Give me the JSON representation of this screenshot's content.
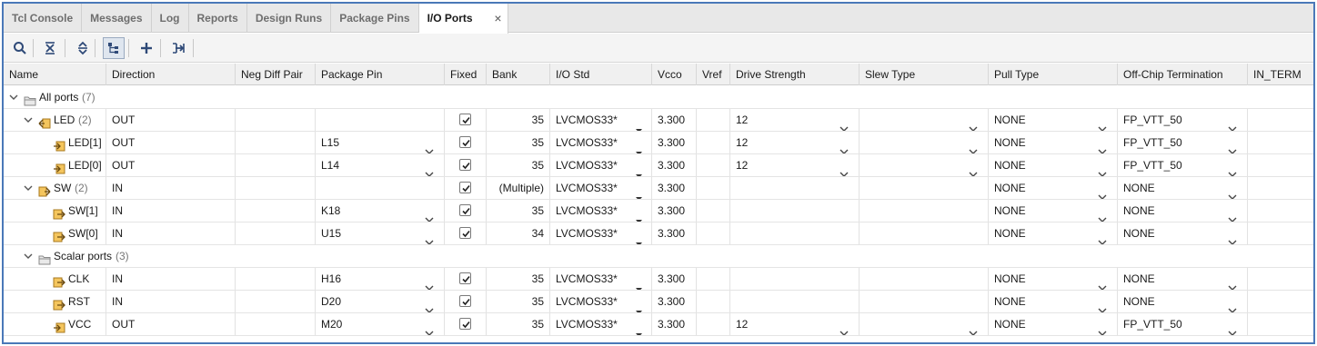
{
  "tabs": [
    {
      "label": "Tcl Console"
    },
    {
      "label": "Messages"
    },
    {
      "label": "Log"
    },
    {
      "label": "Reports"
    },
    {
      "label": "Design Runs"
    },
    {
      "label": "Package Pins"
    },
    {
      "label": "I/O Ports",
      "active": true
    }
  ],
  "toolbar": {
    "icons": [
      "search-icon",
      "collapse-all-icon",
      "expand-all-icon",
      "group-by-interface-icon",
      "add-icon",
      "export-icon"
    ]
  },
  "columns": [
    "Name",
    "Direction",
    "Neg Diff Pair",
    "Package Pin",
    "Fixed",
    "Bank",
    "I/O Std",
    "Vcco",
    "Vref",
    "Drive Strength",
    "Slew Type",
    "Pull Type",
    "Off-Chip Termination",
    "IN_TERM"
  ],
  "rows": [
    {
      "kind": "group",
      "name": "All ports",
      "count": "(7)"
    },
    {
      "kind": "bus",
      "name": "LED",
      "count": "(2)",
      "direction": "OUT",
      "pkg_pin": "",
      "fixed": true,
      "bank": "35",
      "io_std": "LVCMOS33*",
      "vcco": "3.300",
      "drive": "12",
      "slew": "",
      "pull": "NONE",
      "term": "FP_VTT_50"
    },
    {
      "kind": "port",
      "name": "LED[1]",
      "direction": "OUT",
      "pkg_pin": "L15",
      "fixed": true,
      "bank": "35",
      "io_std": "LVCMOS33*",
      "vcco": "3.300",
      "drive": "12",
      "slew": "",
      "pull": "NONE",
      "term": "FP_VTT_50"
    },
    {
      "kind": "port",
      "name": "LED[0]",
      "direction": "OUT",
      "pkg_pin": "L14",
      "fixed": true,
      "bank": "35",
      "io_std": "LVCMOS33*",
      "vcco": "3.300",
      "drive": "12",
      "slew": "",
      "pull": "NONE",
      "term": "FP_VTT_50"
    },
    {
      "kind": "bus",
      "name": "SW",
      "count": "(2)",
      "direction": "IN",
      "pkg_pin": "",
      "fixed": true,
      "bank": "(Multiple)",
      "io_std": "LVCMOS33*",
      "vcco": "3.300",
      "drive": "",
      "slew": "",
      "pull": "NONE",
      "term": "NONE"
    },
    {
      "kind": "port",
      "name": "SW[1]",
      "direction": "IN",
      "pkg_pin": "K18",
      "fixed": true,
      "bank": "35",
      "io_std": "LVCMOS33*",
      "vcco": "3.300",
      "drive": "",
      "slew": "",
      "pull": "NONE",
      "term": "NONE"
    },
    {
      "kind": "port",
      "name": "SW[0]",
      "direction": "IN",
      "pkg_pin": "U15",
      "fixed": true,
      "bank": "34",
      "io_std": "LVCMOS33*",
      "vcco": "3.300",
      "drive": "",
      "slew": "",
      "pull": "NONE",
      "term": "NONE"
    },
    {
      "kind": "group2",
      "name": "Scalar ports",
      "count": "(3)"
    },
    {
      "kind": "port",
      "name": "CLK",
      "direction": "IN",
      "pkg_pin": "H16",
      "fixed": true,
      "bank": "35",
      "io_std": "LVCMOS33*",
      "vcco": "3.300",
      "drive": "",
      "slew": "",
      "pull": "NONE",
      "term": "NONE"
    },
    {
      "kind": "port",
      "name": "RST",
      "direction": "IN",
      "pkg_pin": "D20",
      "fixed": true,
      "bank": "35",
      "io_std": "LVCMOS33*",
      "vcco": "3.300",
      "drive": "",
      "slew": "",
      "pull": "NONE",
      "term": "NONE"
    },
    {
      "kind": "port",
      "name": "VCC",
      "direction": "OUT",
      "pkg_pin": "M20",
      "fixed": true,
      "bank": "35",
      "io_std": "LVCMOS33*",
      "vcco": "3.300",
      "drive": "12",
      "slew": "",
      "pull": "NONE",
      "term": "FP_VTT_50"
    }
  ],
  "colors": {
    "accent": "#4a78b8",
    "header_bg": "#f0f0f0",
    "tab_bg": "#e8e8e8",
    "icon_orange": "#d9a23a"
  }
}
